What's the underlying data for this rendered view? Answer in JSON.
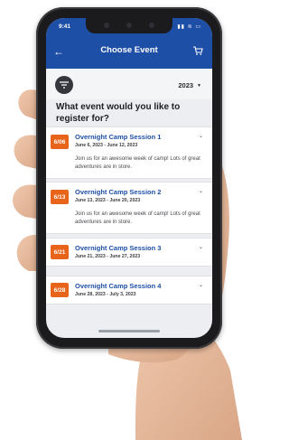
{
  "status_bar": {
    "time": "9:41",
    "icons": "▮▮ ≋ ▭"
  },
  "header": {
    "title": "Choose Event",
    "back_icon": "arrow-left-icon",
    "cart_icon": "cart-icon"
  },
  "filter": {
    "icon": "filter-icon",
    "year": "2023"
  },
  "question": "What event would you like to register for?",
  "events": [
    {
      "badge": "6/06",
      "title": "Overnight Camp Session 1",
      "dates": "June 6, 2023 - June 12, 2023",
      "description": "Join us for an awesome week of camp! Lots of great adventures are in store."
    },
    {
      "badge": "6/13",
      "title": "Overnight Camp Session 2",
      "dates": "June 13, 2023 - June 20, 2023",
      "description": "Join us for an awesome week of camp! Lots of great adventures are in store."
    },
    {
      "badge": "6/21",
      "title": "Overnight Camp Session 3",
      "dates": "June 21, 2023 - June 27, 2023"
    },
    {
      "badge": "6/28",
      "title": "Overnight Camp Session 4",
      "dates": "June 28, 2023 - July 3, 2023"
    }
  ],
  "colors": {
    "header": "#1e4fa6",
    "badge": "#e7641a",
    "accent": "#1e4fa6"
  }
}
